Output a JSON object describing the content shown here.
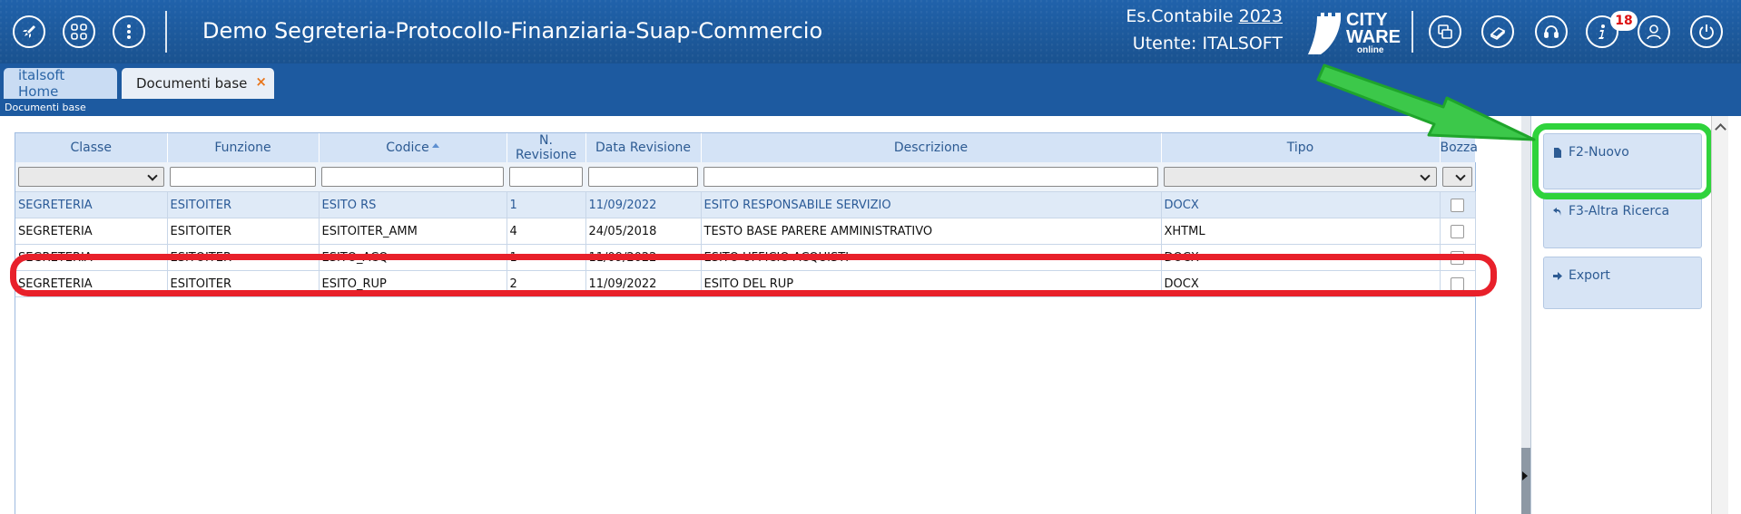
{
  "header": {
    "app_title": "Demo Segreteria-Protocollo-Finanziaria-Suap-Commercio",
    "es_label": "Es.Contabile",
    "es_year": "2023",
    "user_line": "Utente: ITALSOFT",
    "logo": {
      "line1": "CITY",
      "line2": "WARE",
      "line3": "online"
    },
    "notification_count": "18",
    "icons_left": [
      "rocket-icon",
      "grid-icon",
      "more-vertical-icon"
    ],
    "icons_right": [
      "windows-icon",
      "books-icon",
      "headset-icon",
      "info-icon",
      "user-icon",
      "power-icon"
    ]
  },
  "tabs": [
    {
      "label": "italsoft Home"
    },
    {
      "label": "Documenti base",
      "close": "×"
    }
  ],
  "breadcrumb": "Documenti base",
  "table": {
    "columns": [
      "Classe",
      "Funzione",
      "Codice",
      "N. Revisione",
      "Data Revisione",
      "Descrizione",
      "Tipo",
      "Bozza"
    ],
    "rows": [
      [
        "SEGRETERIA",
        "ESITOITER",
        "ESITO RS",
        "1",
        "11/09/2022",
        "ESITO RESPONSABILE SERVIZIO",
        "DOCX"
      ],
      [
        "SEGRETERIA",
        "ESITOITER",
        "ESITOITER_AMM",
        "4",
        "24/05/2018",
        "TESTO BASE PARERE AMMINISTRATIVO",
        "XHTML"
      ],
      [
        "SEGRETERIA",
        "ESITOITER",
        "ESITO_ACQ",
        "1",
        "11/09/2022",
        "ESITO UFFICIO ACQUISTI",
        "DOCX"
      ],
      [
        "SEGRETERIA",
        "ESITOITER",
        "ESITO_RUP",
        "2",
        "11/09/2022",
        "ESITO DEL RUP",
        "DOCX"
      ]
    ]
  },
  "actions": [
    {
      "label": "F2-Nuovo",
      "icon": "document-icon"
    },
    {
      "label": "F3-Altra Ricerca",
      "icon": "back-arrow-icon"
    },
    {
      "label": "Export",
      "icon": "export-arrow-icon"
    }
  ],
  "colors": {
    "header_bg": "#1d5aa0",
    "highlight_red": "#e8202a",
    "highlight_green": "#2fd33c"
  }
}
